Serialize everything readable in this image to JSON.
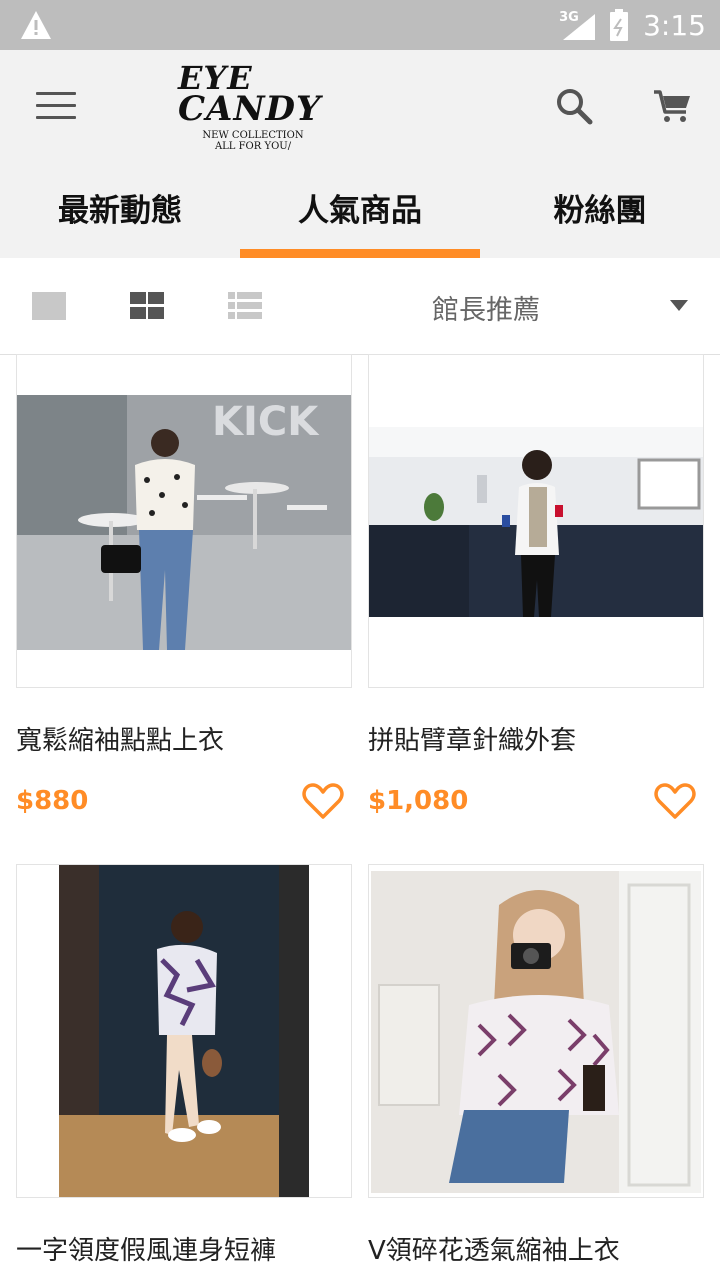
{
  "status_bar": {
    "warning_icon": "warning-icon",
    "network_label": "3G",
    "time": "3:15"
  },
  "header": {
    "logo": {
      "line1": "EYE",
      "line2": "CANDY",
      "tagline1": "NEW COLLECTION",
      "tagline2": "ALL FOR YOU/"
    },
    "icons": [
      "menu-icon",
      "search-icon",
      "cart-icon"
    ]
  },
  "tabs": [
    {
      "label": "最新動態",
      "active": false
    },
    {
      "label": "人氣商品",
      "active": true
    },
    {
      "label": "粉絲團",
      "active": false
    }
  ],
  "toolbar": {
    "view_icons": [
      "single-view-icon",
      "grid-view-icon",
      "list-view-icon"
    ],
    "sort_label": "館長推薦"
  },
  "products": [
    {
      "name": "寬鬆縮袖點點上衣",
      "price": "$880"
    },
    {
      "name": "拼貼臂章針織外套",
      "price": "$1,080"
    },
    {
      "name": "一字領度假風連身短褲",
      "price": ""
    },
    {
      "name": "V領碎花透氣縮袖上衣",
      "price": ""
    }
  ],
  "colors": {
    "accent": "#ff8c26",
    "header_bg": "#f2f2f2",
    "status_bar_bg": "#bdbdbd"
  }
}
